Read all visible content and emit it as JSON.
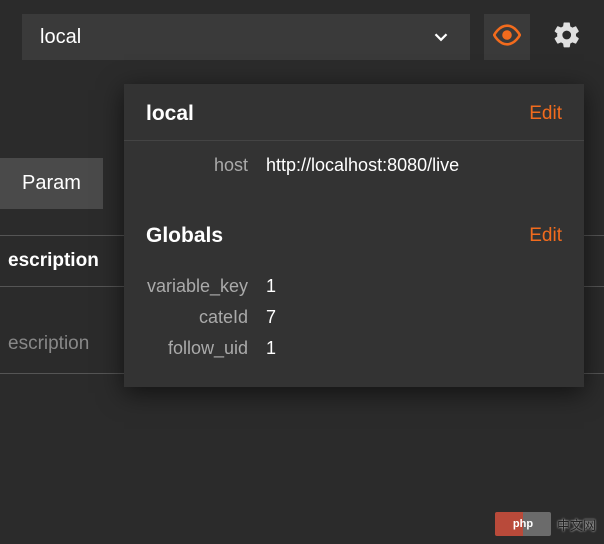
{
  "colors": {
    "accent": "#f26b1d"
  },
  "topbar": {
    "env_label": "local"
  },
  "background": {
    "tab_label": "Param",
    "header": "escription",
    "placeholder": "escription"
  },
  "popover": {
    "sections": [
      {
        "title": "local",
        "edit_label": "Edit",
        "rows": [
          {
            "key": "host",
            "value": "http://localhost:8080/live"
          }
        ]
      },
      {
        "title": "Globals",
        "edit_label": "Edit",
        "rows": [
          {
            "key": "variable_key",
            "value": "1"
          },
          {
            "key": "cateId",
            "value": "7"
          },
          {
            "key": "follow_uid",
            "value": "1"
          }
        ]
      }
    ]
  },
  "watermark": {
    "logo": "php",
    "text": "中文网"
  }
}
